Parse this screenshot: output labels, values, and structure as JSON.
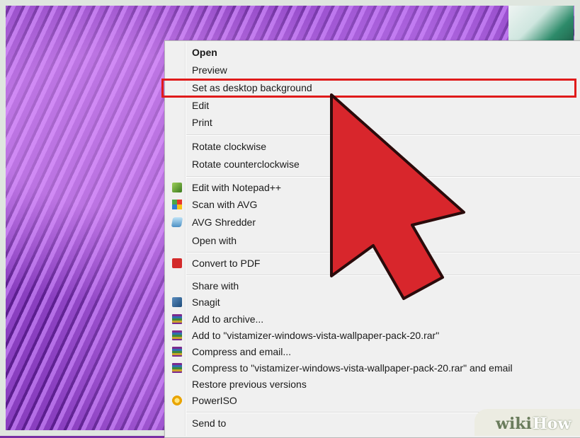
{
  "menu": {
    "items": [
      {
        "label": "Open",
        "bold": true
      },
      {
        "label": "Preview"
      },
      {
        "label": "Set as desktop background"
      },
      {
        "label": "Edit"
      },
      {
        "label": "Print"
      },
      {
        "label": "Rotate clockwise"
      },
      {
        "label": "Rotate counterclockwise"
      },
      {
        "label": "Edit with Notepad++",
        "icon": "notepad-plus-plus-icon"
      },
      {
        "label": "Scan with AVG",
        "icon": "avg-icon"
      },
      {
        "label": "AVG Shredder",
        "icon": "avg-shredder-icon"
      },
      {
        "label": "Open with",
        "submenu": true
      },
      {
        "label": "Convert to PDF",
        "icon": "pdf-icon"
      },
      {
        "label": "Share with",
        "submenu": true
      },
      {
        "label": "Snagit",
        "icon": "snagit-icon",
        "submenu": true
      },
      {
        "label": "Add to archive...",
        "icon": "winrar-icon"
      },
      {
        "label": "Add to \"vistamizer-windows-vista-wallpaper-pack-20.rar\"",
        "icon": "winrar-icon"
      },
      {
        "label": "Compress and email...",
        "icon": "winrar-icon"
      },
      {
        "label": "Compress to \"vistamizer-windows-vista-wallpaper-pack-20.rar\" and email",
        "icon": "winrar-icon"
      },
      {
        "label": "Restore previous versions"
      },
      {
        "label": "PowerISO",
        "icon": "poweriso-icon",
        "submenu": true
      },
      {
        "label": "Send to",
        "submenu": true
      }
    ],
    "submenu_glyph": "▸"
  },
  "watermark": {
    "part1": "wiki",
    "part2": "How"
  },
  "colors": {
    "highlight": "#e01b1b",
    "cursor": "#d8262c"
  }
}
